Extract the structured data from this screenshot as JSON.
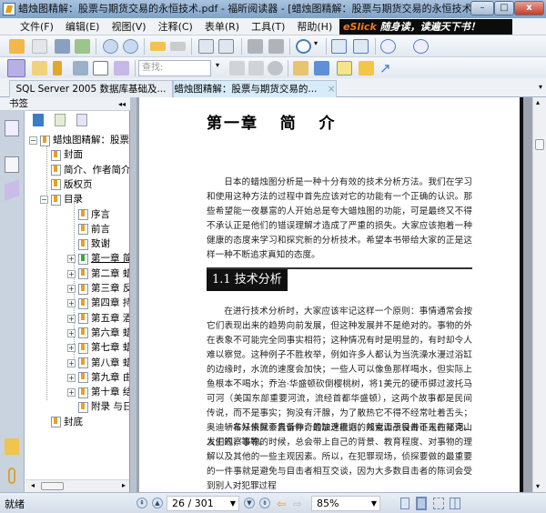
{
  "window": {
    "title": "蜡烛图精解：股票与期货交易的永恒技术.pdf - 福昕阅读器 - [蜡烛图精解：股票与期货交易的永恒技术.pdf]"
  },
  "menu": [
    "文件(F)",
    "编辑(E)",
    "视图(V)",
    "注释(C)",
    "表单(R)",
    "工具(T)",
    "帮助(H)"
  ],
  "banner": {
    "brand": "eSlick",
    "text": " 随身读，读遍天下书！"
  },
  "search": {
    "placeholder": "查找:"
  },
  "tabs": [
    {
      "label": "SQL Server 2005 数据库基础及...",
      "active": false
    },
    {
      "label": "蜡烛图精解：股票与期货交易的...",
      "active": true,
      "close": "×"
    }
  ],
  "bookmarks": {
    "title": "书签",
    "collapse": "◂◂",
    "items": [
      {
        "label": "蜡烛图精解：股票与期货交易的永恒技术",
        "level": 0,
        "expander": "−"
      },
      {
        "label": "封面",
        "level": 1
      },
      {
        "label": "简介、作者简介",
        "level": 1
      },
      {
        "label": "版权页",
        "level": 1
      },
      {
        "label": "目录",
        "level": 1,
        "expander": "−"
      },
      {
        "label": "序言",
        "level": 2
      },
      {
        "label": "前言",
        "level": 2
      },
      {
        "label": "致谢",
        "level": 2
      },
      {
        "label": "第一章  简介",
        "level": 2,
        "expander": "+",
        "selected": true
      },
      {
        "label": "第二章  蜡烛图",
        "level": 2,
        "expander": "+"
      },
      {
        "label": "第三章  反转形态",
        "level": 2,
        "expander": "+"
      },
      {
        "label": "第四章  持续形态",
        "level": 2,
        "expander": "+"
      },
      {
        "label": "第五章  酒田战法",
        "level": 2,
        "expander": "+"
      },
      {
        "label": "第六章  蜡烛图",
        "level": 2,
        "expander": "+"
      },
      {
        "label": "第七章  蜡烛图",
        "level": 2,
        "expander": "+"
      },
      {
        "label": "第八章  蜡烛图",
        "level": 2,
        "expander": "+"
      },
      {
        "label": "第九章  由蜡烛图",
        "level": 2,
        "expander": "+"
      },
      {
        "label": "第十章  结论",
        "level": 2,
        "expander": "+"
      },
      {
        "label": "附录  与日本",
        "level": 2
      },
      {
        "label": "封底",
        "level": 1
      }
    ]
  },
  "document": {
    "chapter_title": "第一章   简   介",
    "para1": "日本的蜡烛图分析是一种十分有效的技术分析方法。我们在学习和使用这种方法的过程中首先应该对它的功能有一个正确的认识。那些希望能一夜暴富的人开始总是夸大蜡烛图的功能，可是最终又不得不承认正是他们的错误理解才造成了严重的损失。大家应该抱着一种健康的态度来学习和探究新的分析技术。希望本书带给大家的正是这样一种不断追求真知的态度。",
    "section_title": "1.1 技术分析",
    "para2": "在进行技术分析时，大家应该牢记这样一个原则：事情通常会按它们表现出来的趋势向前发展，但这种发展并不是绝对的。事物的外在表象不可能完全同事实相符；这种情况有时是明显的，有时却令人难以察觉。这种例子不胜枚举，例如许多人都认为当洗澡水漫过浴缸的边缘时，水流的速度会加快；一些人可以像鱼那样喝水，但实际上鱼根本不喝水；乔治·华盛顿砍倒樱桃树，将1美元的硬币掷过波托马可河（美国东部重要河流，流经首都华盛顿），这两个故事都是民间传说，而不是事实；狗没有汗腺，为了散热它不得不经常吐着舌头；奥迪轿车从来就不具备神奇的加速能力；邦克山战役并不是在邦克山发生的，等等。",
    "para3": "一名好侦探会告诉你，最缺乏根据的线索源于目击证人的证词。人们观察事物的时候，总会带上自己的背景、教育程度、对事物的理解以及其他的一些主观因素。所以，在犯罪现场，侦探要做的最重要的一件事就是避免与目击者相互交谈，因为大多数目击者的陈词会受到别人对犯罪过程"
  },
  "status": {
    "text": "就绪",
    "page": "26 / 301",
    "current_page": 26,
    "total_pages": 301,
    "zoom": "85%"
  }
}
